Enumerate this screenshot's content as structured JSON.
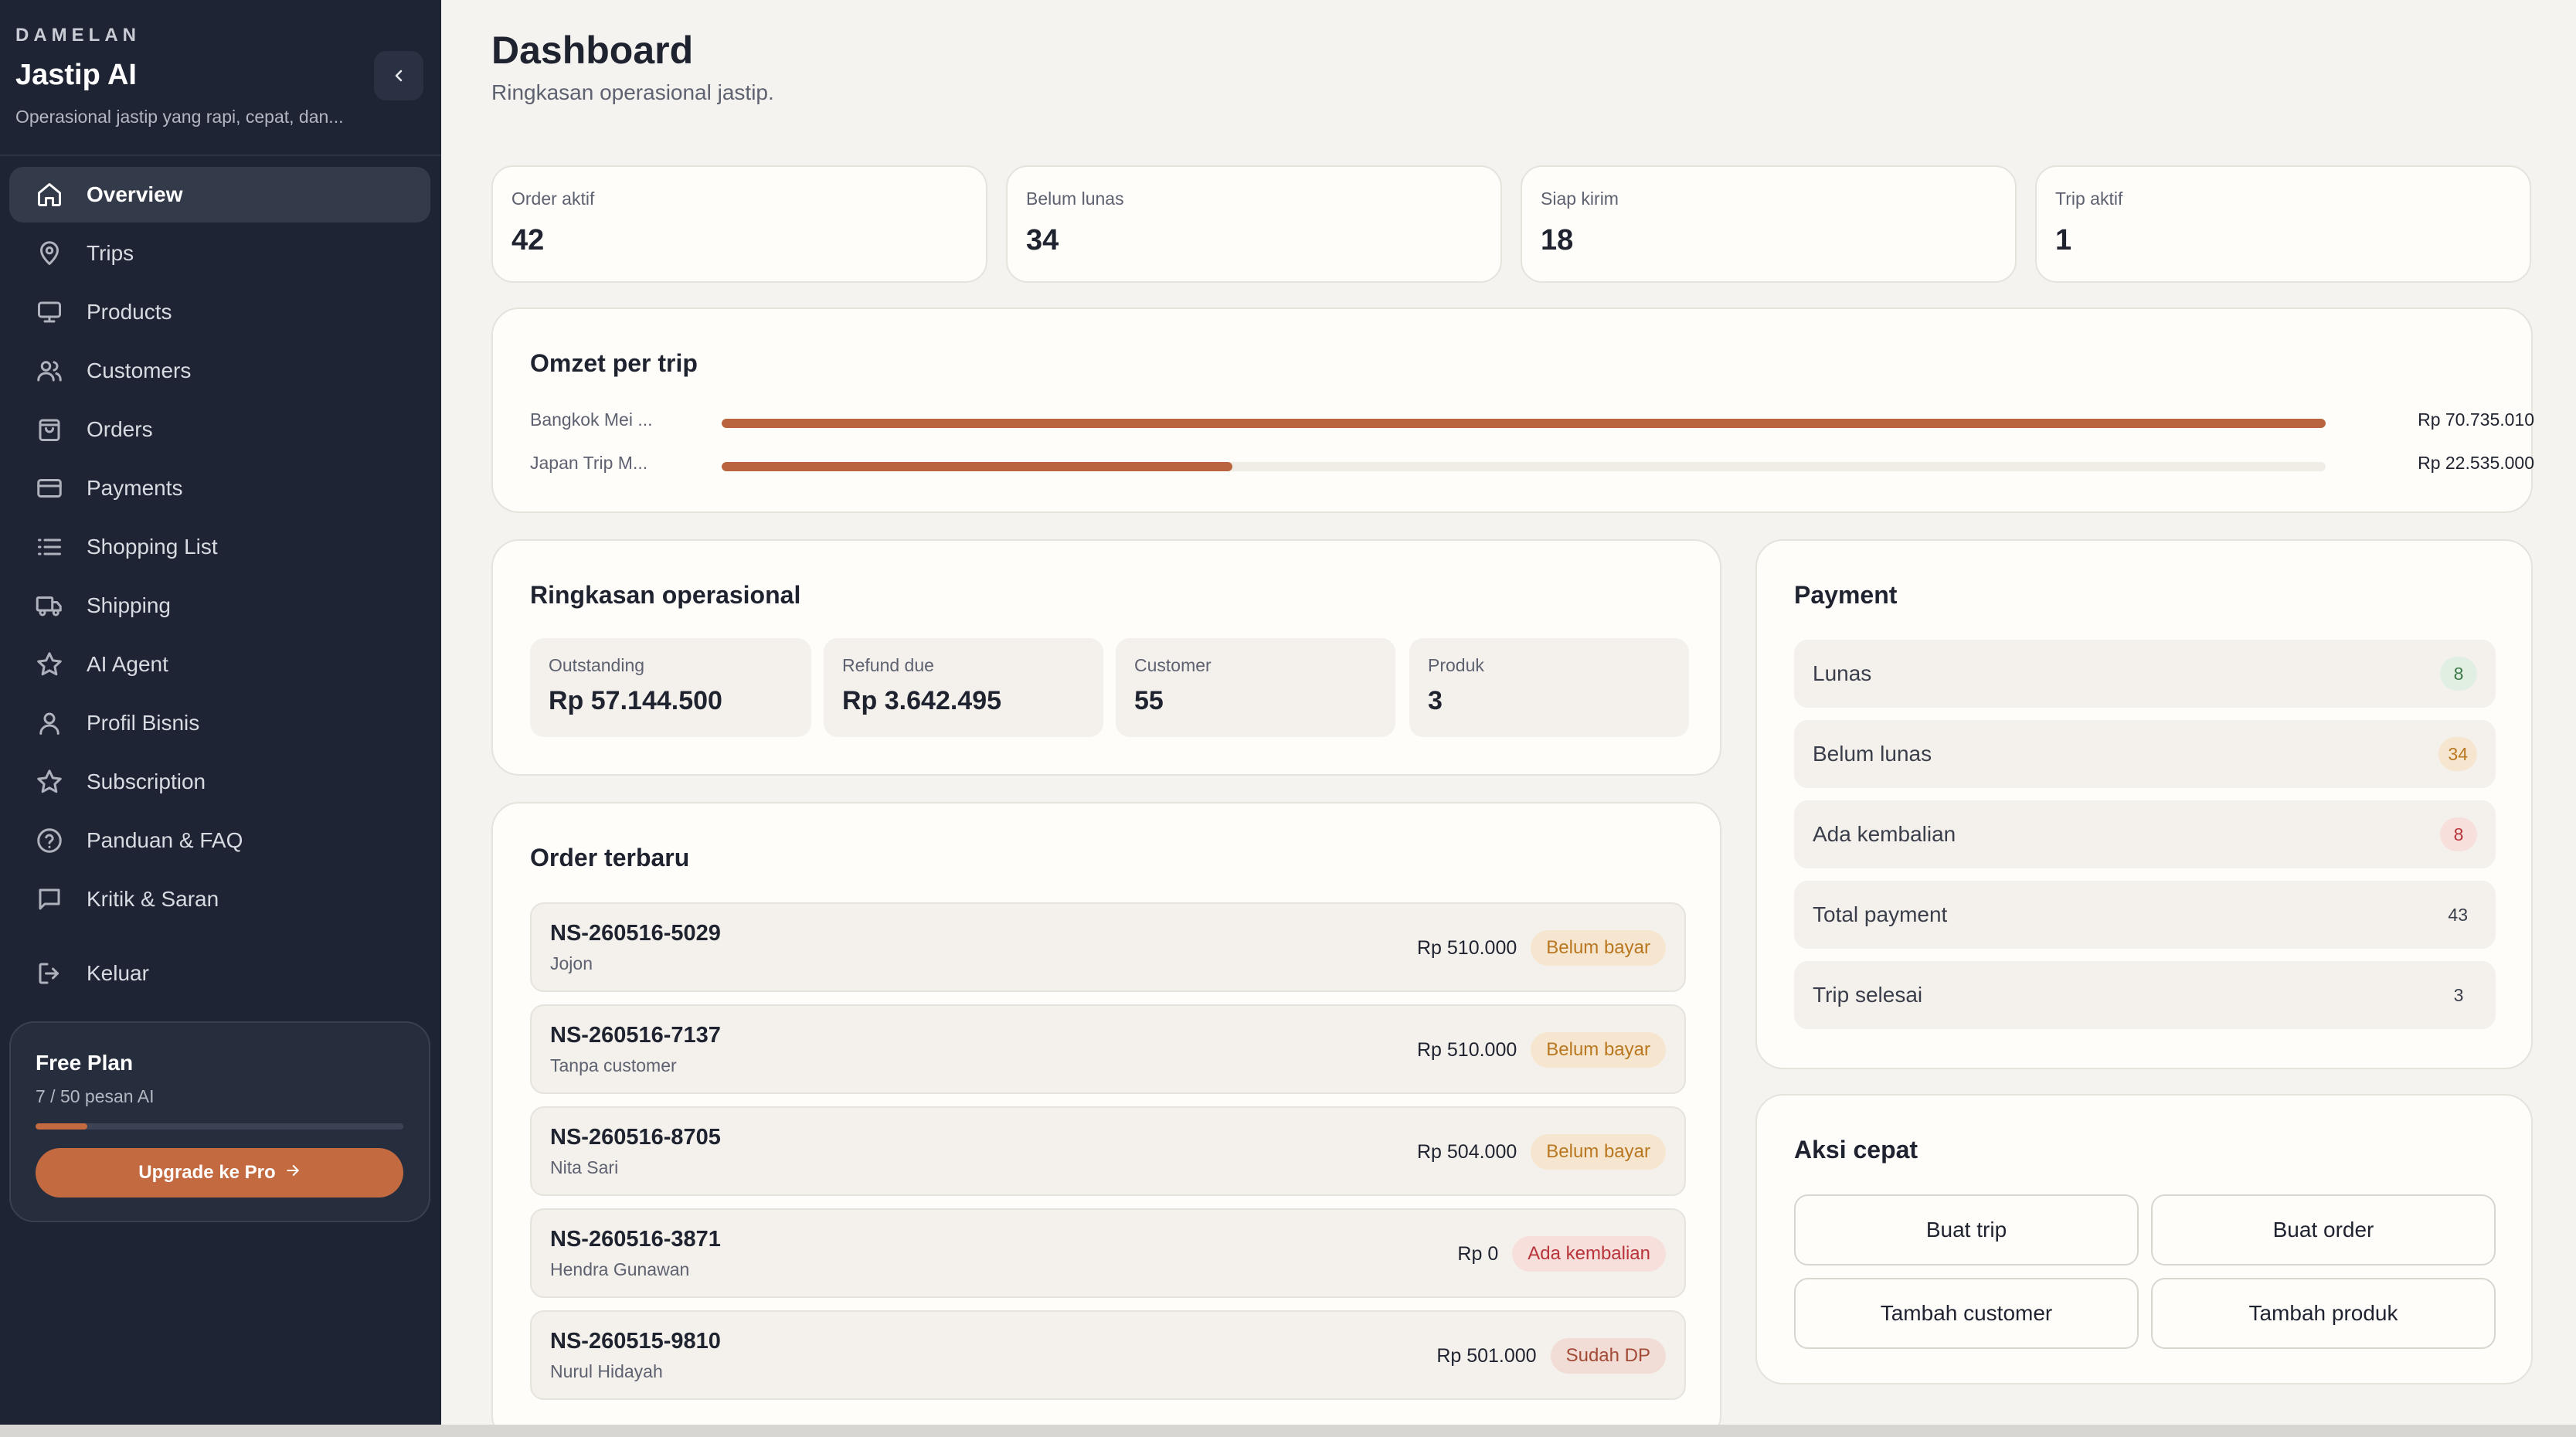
{
  "brand": {
    "eyebrow": "DAMELAN",
    "title": "Jastip AI",
    "subtitle": "Operasional jastip yang rapi, cepat, dan..."
  },
  "sidebar": {
    "items": [
      {
        "label": "Overview",
        "icon": "home-icon",
        "active": true
      },
      {
        "label": "Trips",
        "icon": "map-pin-icon"
      },
      {
        "label": "Products",
        "icon": "monitor-icon"
      },
      {
        "label": "Customers",
        "icon": "users-icon"
      },
      {
        "label": "Orders",
        "icon": "shopping-bag-icon"
      },
      {
        "label": "Payments",
        "icon": "credit-card-icon"
      },
      {
        "label": "Shopping List",
        "icon": "list-icon"
      },
      {
        "label": "Shipping",
        "icon": "truck-icon"
      },
      {
        "label": "AI Agent",
        "icon": "star-icon"
      },
      {
        "label": "Profil Bisnis",
        "icon": "user-icon"
      },
      {
        "label": "Subscription",
        "icon": "star-icon"
      },
      {
        "label": "Panduan & FAQ",
        "icon": "help-circle-icon"
      },
      {
        "label": "Kritik & Saran",
        "icon": "message-square-icon"
      }
    ],
    "logout_label": "Keluar",
    "plan": {
      "title": "Free Plan",
      "usage": "7 / 50 pesan AI",
      "usage_fraction": 0.14,
      "upgrade_label": "Upgrade ke Pro"
    }
  },
  "header": {
    "title": "Dashboard",
    "subtitle": "Ringkasan operasional jastip."
  },
  "stats": [
    {
      "label": "Order aktif",
      "value": "42"
    },
    {
      "label": "Belum lunas",
      "value": "34"
    },
    {
      "label": "Siap kirim",
      "value": "18"
    },
    {
      "label": "Trip aktif",
      "value": "1"
    }
  ],
  "omzet": {
    "title": "Omzet per trip",
    "trips": [
      {
        "name": "Bangkok Mei ...",
        "amount": "Rp 70.735.010",
        "value": 70735010
      },
      {
        "name": "Japan Trip M...",
        "amount": "Rp 22.535.000",
        "value": 22535000
      }
    ]
  },
  "ringkasan": {
    "title": "Ringkasan operasional",
    "items": [
      {
        "label": "Outstanding",
        "value": "Rp 57.144.500"
      },
      {
        "label": "Refund due",
        "value": "Rp 3.642.495"
      },
      {
        "label": "Customer",
        "value": "55"
      },
      {
        "label": "Produk",
        "value": "3"
      }
    ]
  },
  "payment": {
    "title": "Payment",
    "rows": [
      {
        "label": "Lunas",
        "count": "8",
        "tone": "green"
      },
      {
        "label": "Belum lunas",
        "count": "34",
        "tone": "amber"
      },
      {
        "label": "Ada kembalian",
        "count": "8",
        "tone": "red"
      },
      {
        "label": "Total payment",
        "count": "43",
        "tone": "plain"
      },
      {
        "label": "Trip selesai",
        "count": "3",
        "tone": "plain"
      }
    ]
  },
  "orders": {
    "title": "Order terbaru",
    "rows": [
      {
        "id": "NS-260516-5029",
        "customer": "Jojon",
        "amount": "Rp 510.000",
        "status": "Belum bayar",
        "tone": "amber"
      },
      {
        "id": "NS-260516-7137",
        "customer": "Tanpa customer",
        "amount": "Rp 510.000",
        "status": "Belum bayar",
        "tone": "amber"
      },
      {
        "id": "NS-260516-8705",
        "customer": "Nita Sari",
        "amount": "Rp 504.000",
        "status": "Belum bayar",
        "tone": "amber"
      },
      {
        "id": "NS-260516-3871",
        "customer": "Hendra Gunawan",
        "amount": "Rp 0",
        "status": "Ada kembalian",
        "tone": "red"
      },
      {
        "id": "NS-260515-9810",
        "customer": "Nurul Hidayah",
        "amount": "Rp 501.000",
        "status": "Sudah DP",
        "tone": "brown"
      }
    ]
  },
  "quick_actions": {
    "title": "Aksi cepat",
    "buttons": [
      "Buat trip",
      "Buat order",
      "Tambah customer",
      "Tambah produk"
    ]
  },
  "colors": {
    "sidebar_bg": "#1e2433",
    "accent": "#c46a40",
    "page_bg": "#f5f3ef"
  }
}
